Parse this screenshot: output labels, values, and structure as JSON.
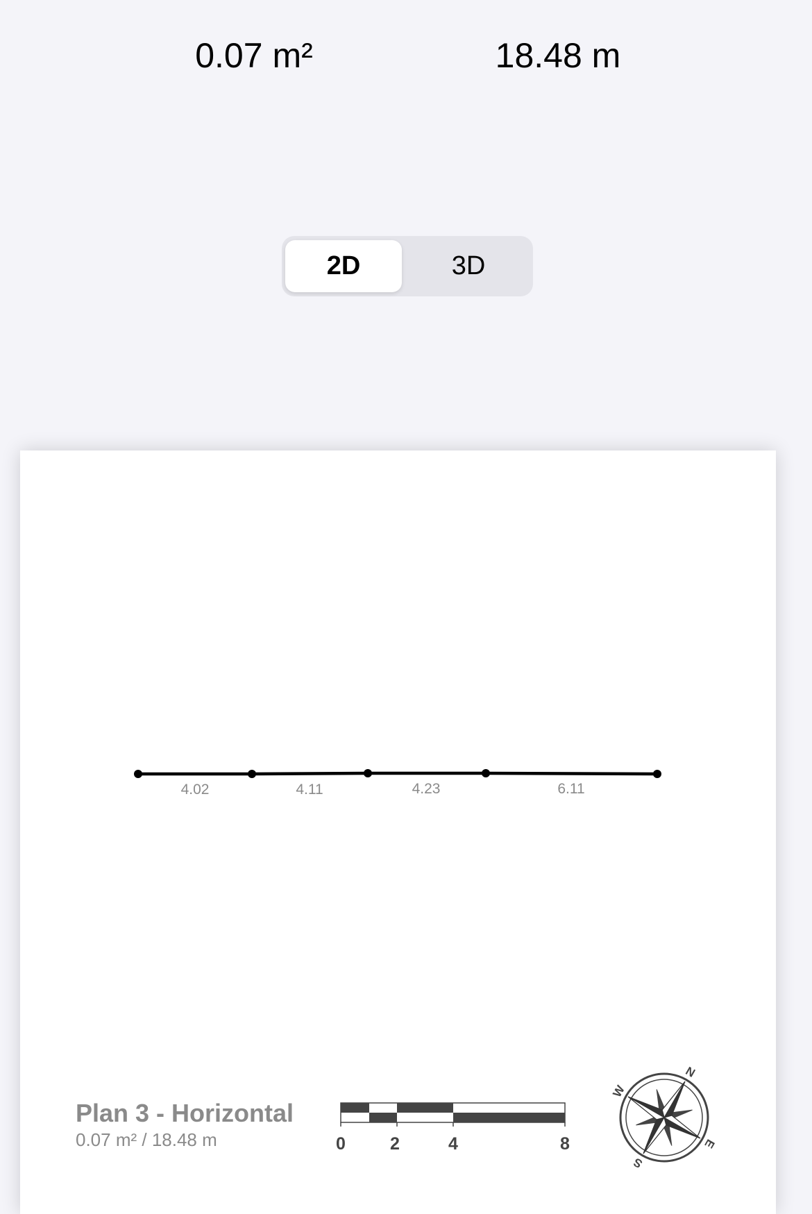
{
  "header": {
    "area": "0.07 m²",
    "perimeter": "18.48 m"
  },
  "view_toggle": {
    "options": [
      "2D",
      "3D"
    ],
    "selected": "2D"
  },
  "plan": {
    "title": "Plan 3 - Horizontal",
    "subtitle": "0.07 m² / 18.48 m",
    "segment_labels": [
      "4.02",
      "4.11",
      "4.23",
      "6.11"
    ],
    "scale_bar_labels": [
      "0",
      "2",
      "4",
      "8"
    ],
    "compass_labels": [
      "N",
      "E",
      "S",
      "W"
    ]
  }
}
